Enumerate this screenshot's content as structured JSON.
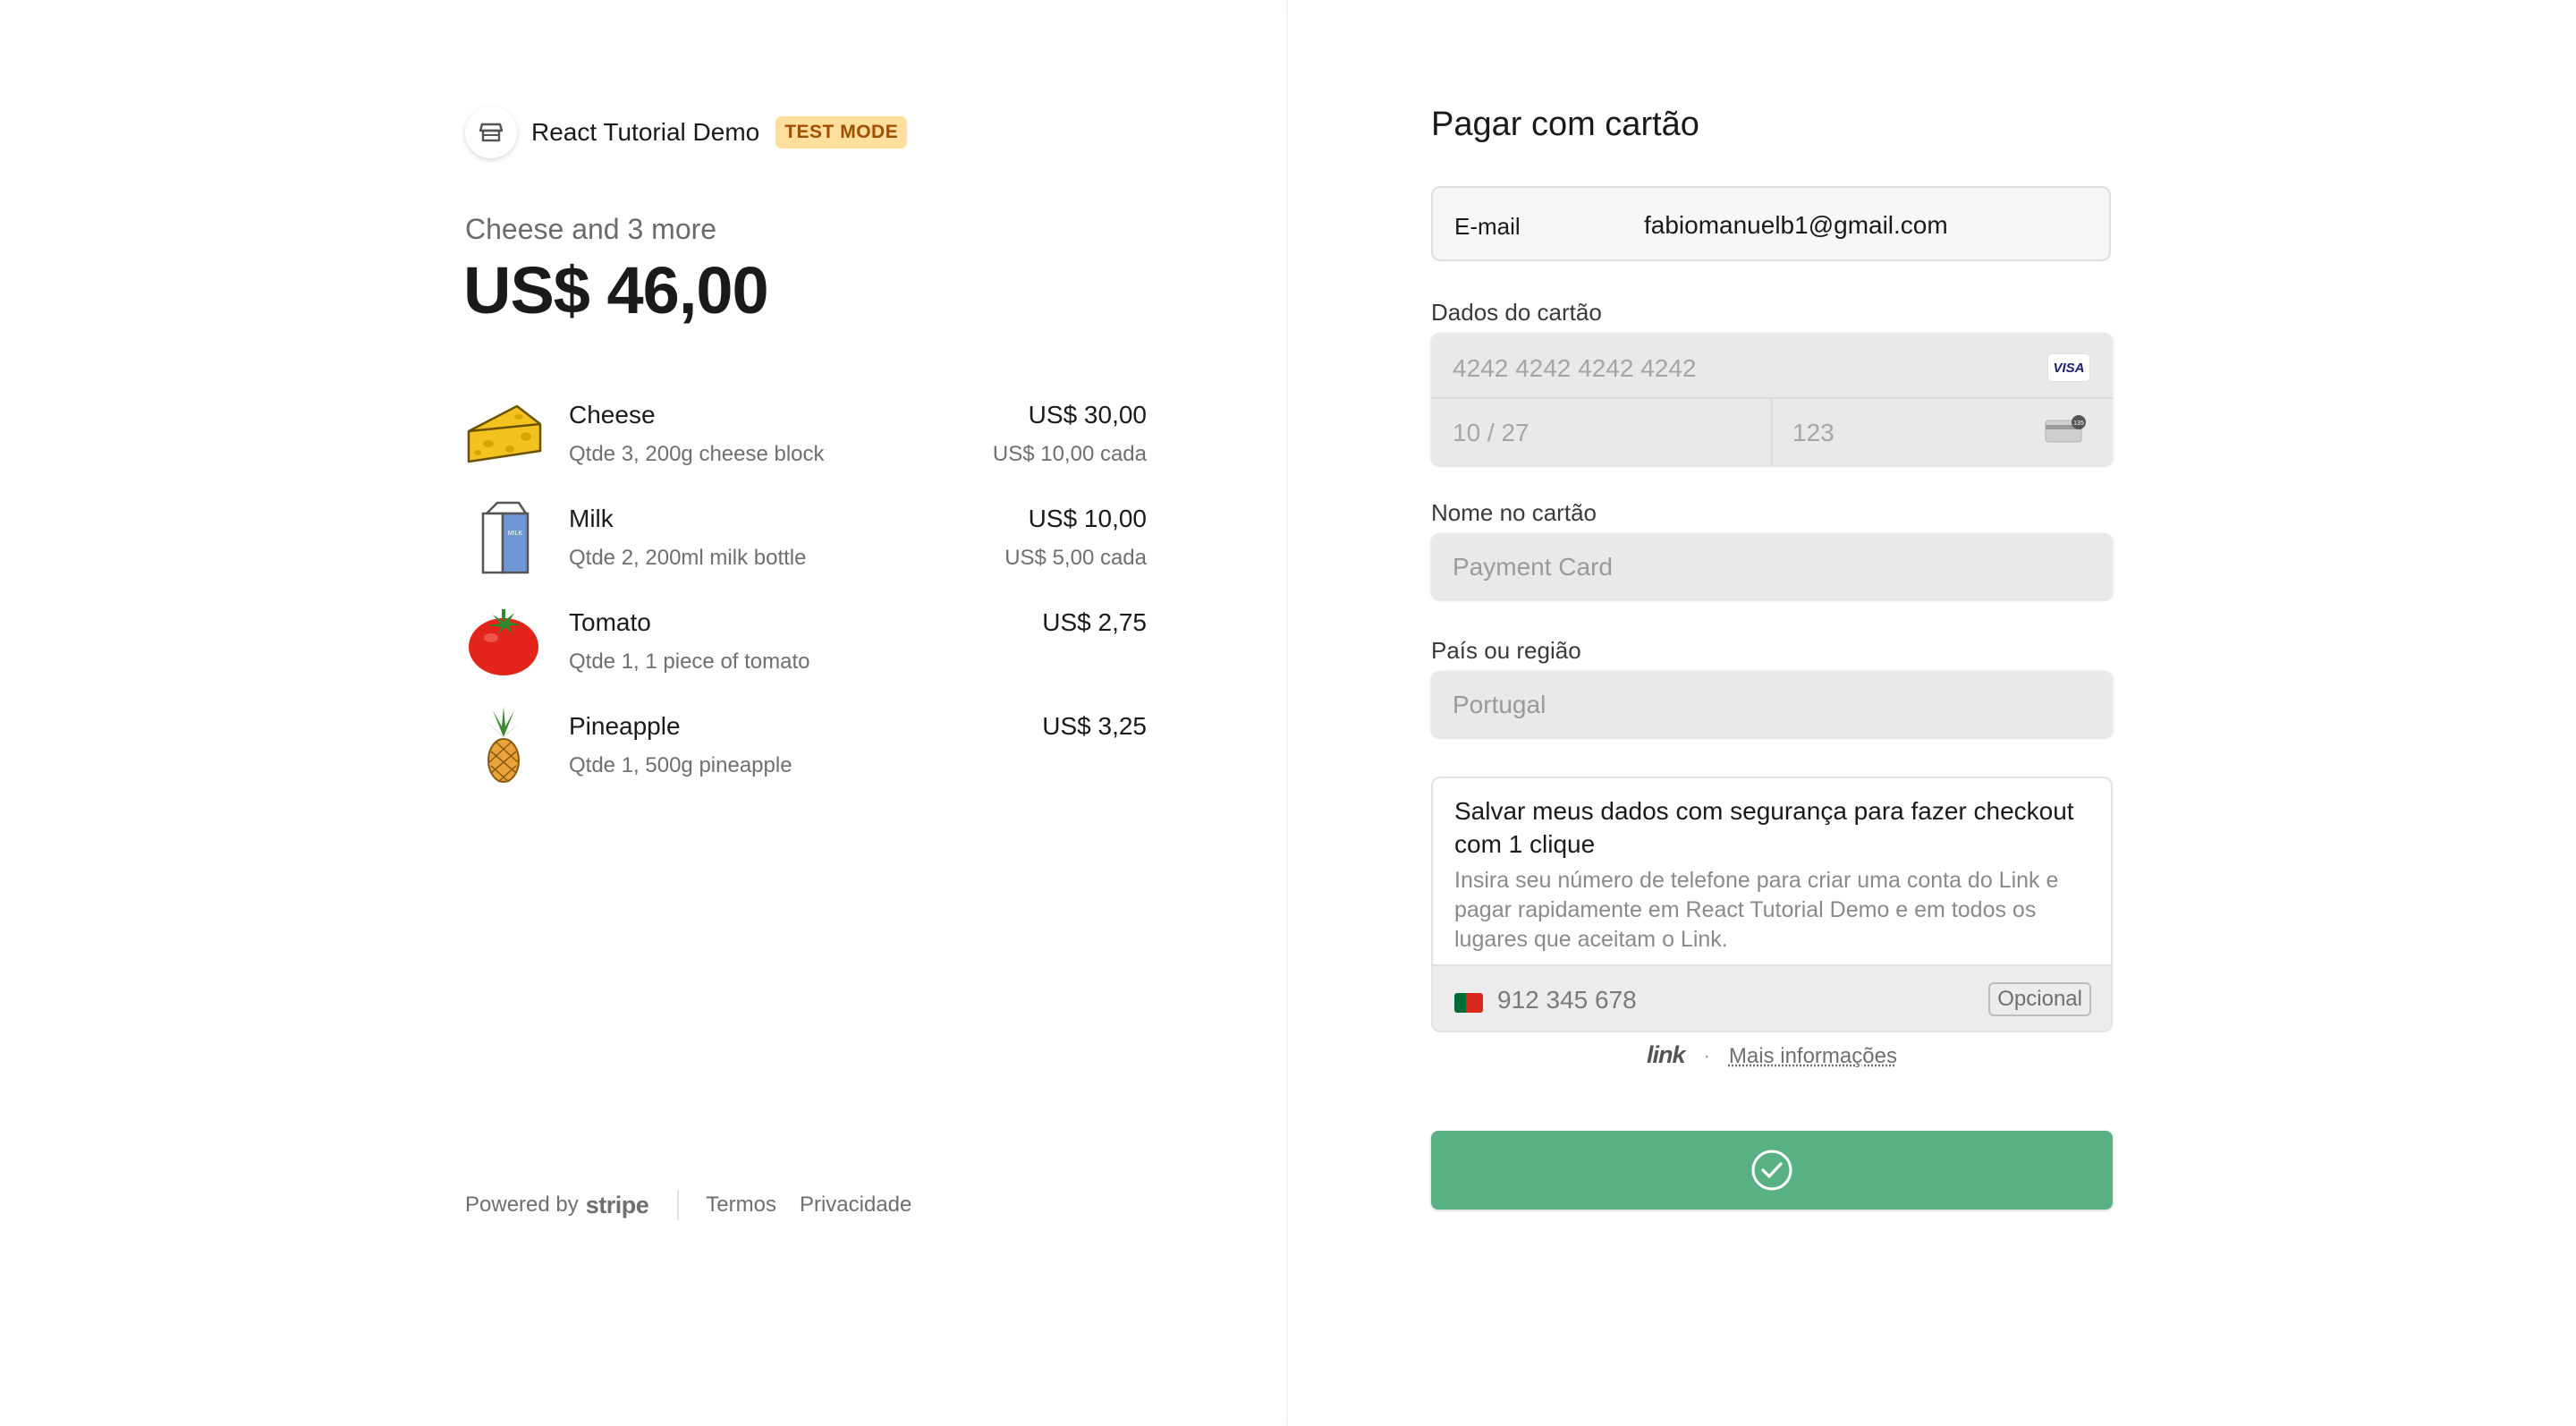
{
  "merchant": {
    "name": "React Tutorial Demo",
    "badge": "TEST MODE",
    "logo_icon": "storefront-icon"
  },
  "summary": {
    "label": "Cheese and 3 more",
    "total": "US$ 46,00"
  },
  "items": [
    {
      "icon": "cheese-image",
      "name": "Cheese",
      "desc": "Qtde 3, 200g cheese block",
      "price": "US$ 30,00",
      "unit": "US$ 10,00 cada"
    },
    {
      "icon": "milk-image",
      "name": "Milk",
      "desc": "Qtde 2, 200ml milk bottle",
      "price": "US$ 10,00",
      "unit": "US$ 5,00 cada"
    },
    {
      "icon": "tomato-image",
      "name": "Tomato",
      "desc": "Qtde 1, 1 piece of tomato",
      "price": "US$ 2,75",
      "unit": ""
    },
    {
      "icon": "pineapple-image",
      "name": "Pineapple",
      "desc": "Qtde 1, 500g pineapple",
      "price": "US$ 3,25",
      "unit": ""
    }
  ],
  "footer": {
    "powered": "Powered by",
    "stripe": "stripe",
    "terms": "Termos",
    "privacy": "Privacidade"
  },
  "form": {
    "title": "Pagar com cartão",
    "email_label": "E-mail",
    "email_value": "fabiomanuelb1@gmail.com",
    "card_label": "Dados do cartão",
    "card_number_placeholder": "4242 4242 4242 4242",
    "card_brand": "VISA",
    "expiry_placeholder": "10 / 27",
    "cvc_placeholder": "123",
    "name_label": "Nome no cartão",
    "name_placeholder": "Payment Card",
    "country_label": "País ou região",
    "country_value": "Portugal"
  },
  "link": {
    "title": "Salvar meus dados com segurança para fazer checkout com 1 clique",
    "desc": "Insira seu número de telefone para criar uma conta do Link e pagar rapidamente em React Tutorial Demo e em todos os lugares que aceitam o Link.",
    "phone_placeholder": "912 345 678",
    "optional": "Opcional",
    "logo": "link",
    "dot": "·",
    "more_info": "Mais informações"
  },
  "pay_button": {
    "state": "success",
    "icon": "check-circle-icon",
    "color": "#58b183"
  },
  "colors": {
    "badge_bg": "#ffdf9b",
    "badge_text": "#a04f00",
    "button": "#58b183"
  }
}
